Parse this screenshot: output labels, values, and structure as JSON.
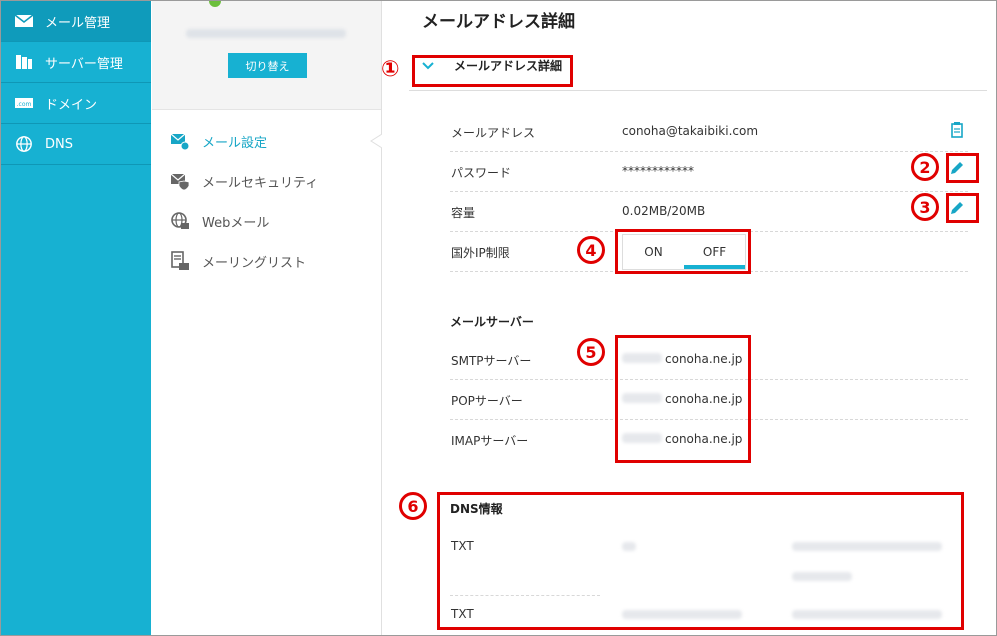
{
  "nav": {
    "items": [
      {
        "label": "メール管理",
        "icon": "mail-icon",
        "active": true
      },
      {
        "label": "サーバー管理",
        "icon": "server-icon",
        "active": false
      },
      {
        "label": "ドメイン",
        "icon": "domain-icon",
        "active": false
      },
      {
        "label": "DNS",
        "icon": "globe-icon",
        "active": false
      }
    ]
  },
  "account": {
    "switch_label": "切り替え"
  },
  "menu": {
    "items": [
      {
        "label": "メール設定",
        "icon": "mail-settings-icon",
        "active": true
      },
      {
        "label": "メールセキュリティ",
        "icon": "mail-security-icon",
        "active": false
      },
      {
        "label": "Webメール",
        "icon": "webmail-icon",
        "active": false
      },
      {
        "label": "メーリングリスト",
        "icon": "mailing-list-icon",
        "active": false
      }
    ]
  },
  "main": {
    "page_title": "メールアドレス詳細",
    "section_title": "メールアドレス詳細",
    "fields": {
      "email_label": "メールアドレス",
      "email_value": "conoha@takaibiki.com",
      "password_label": "パスワード",
      "password_value": "************",
      "capacity_label": "容量",
      "capacity_value": "0.02MB/20MB",
      "foreign_ip_label": "国外IP制限",
      "toggle_on": "ON",
      "toggle_off": "OFF"
    },
    "mail_server": {
      "title": "メールサーバー",
      "smtp_label": "SMTPサーバー",
      "smtp_value": "conoha.ne.jp",
      "pop_label": "POPサーバー",
      "pop_value": "conoha.ne.jp",
      "imap_label": "IMAPサーバー",
      "imap_value": "conoha.ne.jp"
    },
    "dns": {
      "title": "DNS情報",
      "row1_type": "TXT",
      "row2_type": "TXT"
    }
  },
  "annotations": {
    "n1": "①",
    "n2": "2",
    "n3": "3",
    "n4": "4",
    "n5": "5",
    "n6": "6"
  },
  "colors": {
    "accent": "#17b1d2",
    "annotation": "#e00000"
  }
}
